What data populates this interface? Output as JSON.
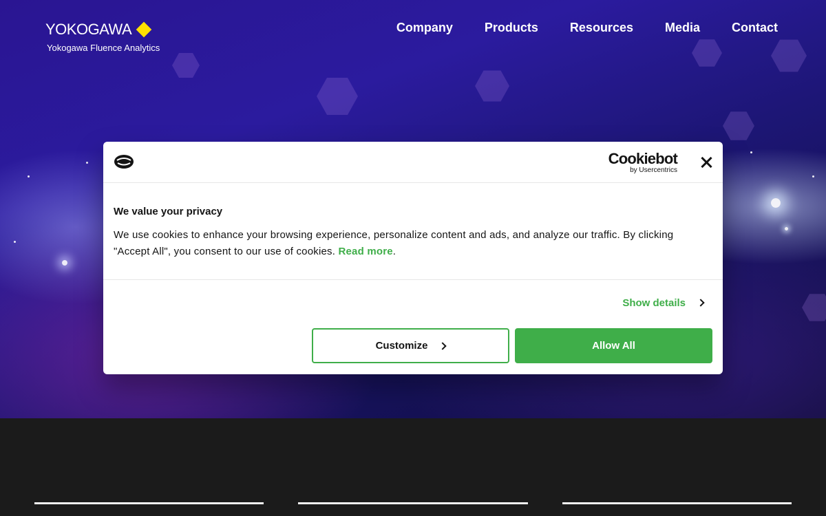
{
  "header": {
    "logo_word": "YOKOGAWA",
    "logo_subtitle": "Yokogawa Fluence Analytics",
    "brand_color": "#ffe000",
    "nav": [
      {
        "label": "Company"
      },
      {
        "label": "Products"
      },
      {
        "label": "Resources"
      },
      {
        "label": "Media"
      },
      {
        "label": "Contact"
      }
    ]
  },
  "cookie_dialog": {
    "brand_main": "Cookiebot",
    "brand_sub": "by Usercentrics",
    "title": "We value your privacy",
    "text": "We use cookies to enhance your browsing experience, personalize content and ads, and analyze our traffic. By clicking \"Accept All\", you consent to our use of cookies. ",
    "read_more": "Read more",
    "period": ".",
    "show_details": "Show details",
    "customize_label": "Customize",
    "allow_all_label": "Allow All",
    "accent_color": "#3fae49"
  },
  "icons": {
    "close": "close-icon",
    "cookie": "cookie-icon",
    "chevron": "chevron-right-icon"
  }
}
